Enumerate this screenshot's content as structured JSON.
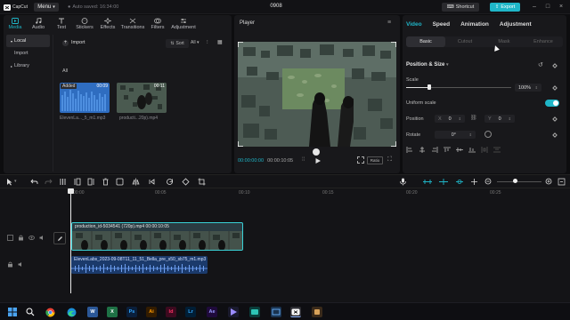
{
  "app": {
    "logo_label": "CapCut",
    "menu_label": "Menu",
    "autosave_label": "Auto saved: 16:34:00",
    "project_title": "0908",
    "shortcut_label": "Shortcut",
    "export_label": "Export",
    "accent_color": "#1fb6c8"
  },
  "media_panel": {
    "tabs": [
      {
        "label": "Media",
        "icon": "media-icon",
        "active": true
      },
      {
        "label": "Audio",
        "icon": "audio-icon"
      },
      {
        "label": "Text",
        "icon": "text-icon"
      },
      {
        "label": "Stickers",
        "icon": "stickers-icon"
      },
      {
        "label": "Effects",
        "icon": "effects-icon"
      },
      {
        "label": "Transitions",
        "icon": "transitions-icon"
      },
      {
        "label": "Filters",
        "icon": "filters-icon"
      },
      {
        "label": "Adjustment",
        "icon": "adjustment-icon"
      }
    ],
    "side_items": [
      {
        "label": "Local",
        "active": true
      },
      {
        "label": "Import"
      },
      {
        "label": "Library"
      }
    ],
    "import_label": "Import",
    "sort_label": "Sort",
    "all_label": "All",
    "thumbnails": [
      {
        "badge": "Added",
        "duration": "00:09",
        "caption": "ElevenLa..._5_m1.mp3",
        "type": "audio"
      },
      {
        "badge": "",
        "duration": "00:11",
        "caption": "producti...20p).mp4",
        "type": "video"
      }
    ]
  },
  "player": {
    "title": "Player",
    "current_time": "00:00:00:00",
    "total_time": "00:00:10:05",
    "ratio_label": "Ratio"
  },
  "inspector": {
    "tabs": [
      {
        "label": "Video",
        "active": true
      },
      {
        "label": "Speed"
      },
      {
        "label": "Animation"
      },
      {
        "label": "Adjustment"
      }
    ],
    "subtabs": [
      {
        "label": "Basic",
        "active": true
      },
      {
        "label": "Cutout"
      },
      {
        "label": "Mask"
      },
      {
        "label": "Enhance"
      }
    ],
    "section_title": "Position & Size",
    "scale_label": "Scale",
    "scale_value": "100%",
    "scale_fraction": 0.22,
    "uniform_scale_label": "Uniform scale",
    "uniform_scale_on": true,
    "position_label": "Position",
    "pos_x_label": "X",
    "pos_x_value": "0",
    "pos_y_label": "Y",
    "pos_y_value": "0",
    "rotate_label": "Rotate",
    "rotate_value": "0°"
  },
  "timeline": {
    "ruler_ticks": [
      "00:00",
      "00:05",
      "00:10",
      "00:15",
      "00:20",
      "00:25"
    ],
    "video_clip_label": "production_id-5034541 (720p).mp4   00:00:10:05",
    "audio_clip_label": "ElevenLabs_2023-09-08T11_11_51_Bella_pre_s50_sb75_m1.mp3",
    "clip_color": "#3ad0d6",
    "audio_color": "#1b3a6b"
  },
  "taskbar": {
    "apps": [
      {
        "icon": "windows-icon"
      },
      {
        "icon": "search-icon"
      },
      {
        "icon": "chrome-icon"
      },
      {
        "icon": "edge-icon"
      },
      {
        "icon": "word-icon",
        "label": "W"
      },
      {
        "icon": "excel-icon",
        "label": "X"
      },
      {
        "icon": "photoshop-icon",
        "label": "Ps"
      },
      {
        "icon": "illustrator-icon",
        "label": "Ai"
      },
      {
        "icon": "indesign-icon",
        "label": "Id"
      },
      {
        "icon": "lightroom-icon",
        "label": "Lr"
      },
      {
        "icon": "aftereffects-icon",
        "label": "Ae"
      },
      {
        "icon": "premiere-icon",
        "label": ""
      },
      {
        "icon": "media-player-icon"
      },
      {
        "icon": "screenshot-icon"
      },
      {
        "icon": "capcut-icon"
      },
      {
        "icon": "app-icon"
      }
    ]
  }
}
